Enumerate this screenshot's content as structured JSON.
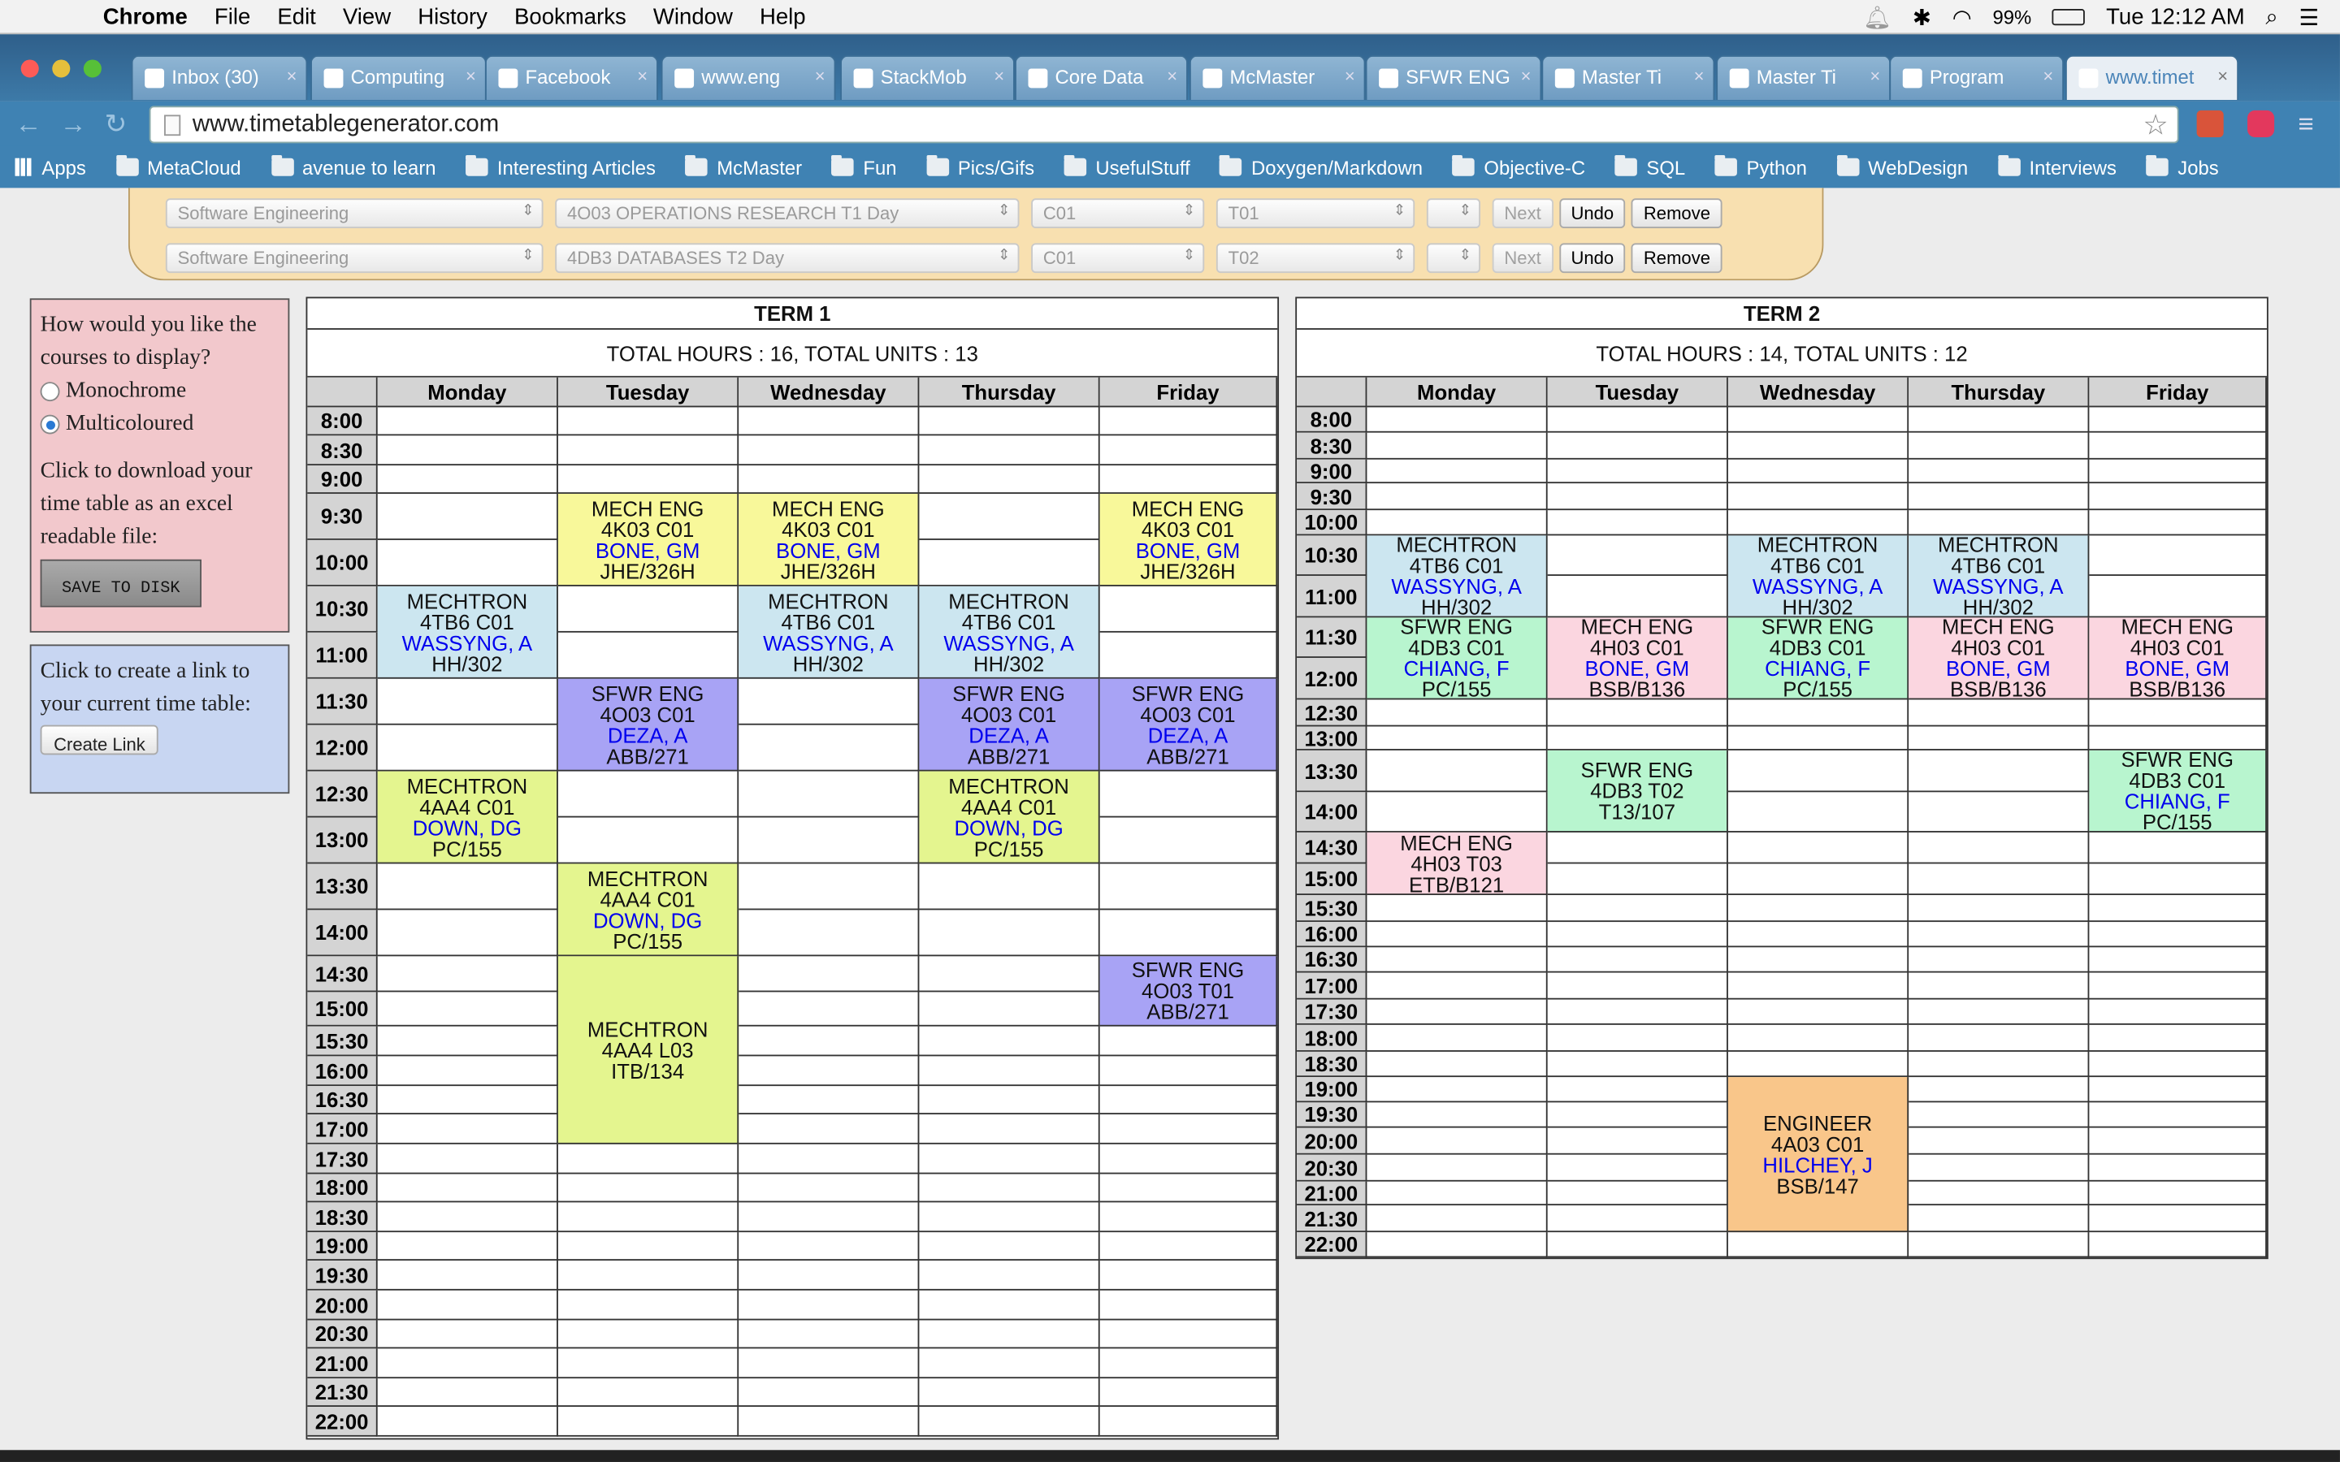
{
  "menubar": {
    "app": "Chrome",
    "items": [
      "File",
      "Edit",
      "View",
      "History",
      "Bookmarks",
      "Window",
      "Help"
    ],
    "battery": "99%",
    "clock": "Tue 12:12 AM"
  },
  "tabs": [
    "Inbox (30)",
    "Computing",
    "Facebook",
    "www.eng",
    "StackMob",
    "Core Data",
    "McMaster",
    "SFWR ENG",
    "Master Ti",
    "Master Ti",
    "Program",
    "www.timet"
  ],
  "url": "www.timetablegenerator.com",
  "bookmarks": [
    "Apps",
    "MetaCloud",
    "avenue to learn",
    "Interesting Articles",
    "McMaster",
    "Fun",
    "Pics/Gifs",
    "UsefulStuff",
    "Doxygen/Markdown",
    "Objective-C",
    "SQL",
    "Python",
    "WebDesign",
    "Interviews",
    "Jobs"
  ],
  "course_rows": [
    {
      "dept": "Software Engineering",
      "course": "4O03 OPERATIONS RESEARCH T1 Day",
      "lec": "C01",
      "tut": "T01",
      "next": "Next",
      "undo": "Undo",
      "remove": "Remove"
    },
    {
      "dept": "Software Engineering",
      "course": "4DB3 DATABASES T2 Day",
      "lec": "C01",
      "tut": "T02",
      "next": "Next",
      "undo": "Undo",
      "remove": "Remove"
    }
  ],
  "sidebar": {
    "display_q": "How would you like the courses to display?",
    "mono": "Monochrome",
    "multi": "Multicoloured",
    "download_text": "Click to download your time table as an excel readable file:",
    "save": "SAVE TO DISK",
    "link_text": "Click to create a link to your current time table:",
    "create_link": "Create Link"
  },
  "days": [
    "Monday",
    "Tuesday",
    "Wednesday",
    "Thursday",
    "Friday"
  ],
  "colors": {
    "yellow": "#f8f89a",
    "blue": "#cce6f0",
    "purple": "#a8a3f5",
    "lime": "#e4f58f",
    "green": "#b8f5cf",
    "pink": "#fbd6e0",
    "orange": "#f9c68a"
  },
  "term1": {
    "title": "TERM 1",
    "totals": "TOTAL HOURS : 16, TOTAL UNITS : 13",
    "times": [
      "8:00",
      "8:30",
      "9:00",
      "9:30",
      "10:00",
      "10:30",
      "11:00",
      "11:30",
      "12:00",
      "12:30",
      "13:00",
      "13:30",
      "14:00",
      "14:30",
      "15:00",
      "15:30",
      "16:00",
      "16:30",
      "17:00",
      "17:30",
      "18:00",
      "18:30",
      "19:00",
      "19:30",
      "20:00",
      "20:30",
      "21:00",
      "21:30",
      "22:00"
    ],
    "courses": [
      {
        "day": 1,
        "start": 3,
        "len": 2,
        "color": "yellow",
        "lines": [
          "MECH ENG",
          "4K03 C01",
          "BONE, GM",
          "JHE/326H"
        ]
      },
      {
        "day": 2,
        "start": 3,
        "len": 2,
        "color": "yellow",
        "lines": [
          "MECH ENG",
          "4K03 C01",
          "BONE, GM",
          "JHE/326H"
        ]
      },
      {
        "day": 4,
        "start": 3,
        "len": 2,
        "color": "yellow",
        "lines": [
          "MECH ENG",
          "4K03 C01",
          "BONE, GM",
          "JHE/326H"
        ]
      },
      {
        "day": 0,
        "start": 5,
        "len": 2,
        "color": "blue",
        "lines": [
          "MECHTRON",
          "4TB6 C01",
          "WASSYNG, A",
          "HH/302"
        ]
      },
      {
        "day": 2,
        "start": 5,
        "len": 2,
        "color": "blue",
        "lines": [
          "MECHTRON",
          "4TB6 C01",
          "WASSYNG, A",
          "HH/302"
        ]
      },
      {
        "day": 3,
        "start": 5,
        "len": 2,
        "color": "blue",
        "lines": [
          "MECHTRON",
          "4TB6 C01",
          "WASSYNG, A",
          "HH/302"
        ]
      },
      {
        "day": 1,
        "start": 7,
        "len": 2,
        "color": "purple",
        "lines": [
          "SFWR ENG",
          "4O03 C01",
          "DEZA, A",
          "ABB/271"
        ]
      },
      {
        "day": 3,
        "start": 7,
        "len": 2,
        "color": "purple",
        "lines": [
          "SFWR ENG",
          "4O03 C01",
          "DEZA, A",
          "ABB/271"
        ]
      },
      {
        "day": 4,
        "start": 7,
        "len": 2,
        "color": "purple",
        "lines": [
          "SFWR ENG",
          "4O03 C01",
          "DEZA, A",
          "ABB/271"
        ]
      },
      {
        "day": 0,
        "start": 9,
        "len": 2,
        "color": "lime",
        "lines": [
          "MECHTRON",
          "4AA4 C01",
          "DOWN, DG",
          "PC/155"
        ]
      },
      {
        "day": 3,
        "start": 9,
        "len": 2,
        "color": "lime",
        "lines": [
          "MECHTRON",
          "4AA4 C01",
          "DOWN, DG",
          "PC/155"
        ]
      },
      {
        "day": 1,
        "start": 11,
        "len": 2,
        "color": "lime",
        "lines": [
          "MECHTRON",
          "4AA4 C01",
          "DOWN, DG",
          "PC/155"
        ]
      },
      {
        "day": 4,
        "start": 13,
        "len": 2,
        "color": "purple",
        "lines": [
          "SFWR ENG",
          "4O03 T01",
          "",
          "ABB/271"
        ]
      },
      {
        "day": 1,
        "start": 13,
        "len": 6,
        "color": "lime",
        "lines": [
          "MECHTRON",
          "4AA4 L03",
          "",
          "ITB/134"
        ]
      }
    ]
  },
  "term2": {
    "title": "TERM 2",
    "totals": "TOTAL HOURS : 14, TOTAL UNITS : 12",
    "times": [
      "8:00",
      "8:30",
      "9:00",
      "9:30",
      "10:00",
      "10:30",
      "11:00",
      "11:30",
      "12:00",
      "12:30",
      "13:00",
      "13:30",
      "14:00",
      "14:30",
      "15:00",
      "15:30",
      "16:00",
      "16:30",
      "17:00",
      "17:30",
      "18:00",
      "18:30",
      "19:00",
      "19:30",
      "20:00",
      "20:30",
      "21:00",
      "21:30",
      "22:00"
    ],
    "courses": [
      {
        "day": 0,
        "start": 5,
        "len": 2,
        "color": "blue",
        "lines": [
          "MECHTRON",
          "4TB6 C01",
          "WASSYNG, A",
          "HH/302"
        ]
      },
      {
        "day": 2,
        "start": 5,
        "len": 2,
        "color": "blue",
        "lines": [
          "MECHTRON",
          "4TB6 C01",
          "WASSYNG, A",
          "HH/302"
        ]
      },
      {
        "day": 3,
        "start": 5,
        "len": 2,
        "color": "blue",
        "lines": [
          "MECHTRON",
          "4TB6 C01",
          "WASSYNG, A",
          "HH/302"
        ]
      },
      {
        "day": 0,
        "start": 7,
        "len": 2,
        "color": "green",
        "lines": [
          "SFWR ENG",
          "4DB3 C01",
          "CHIANG, F",
          "PC/155"
        ]
      },
      {
        "day": 2,
        "start": 7,
        "len": 2,
        "color": "green",
        "lines": [
          "SFWR ENG",
          "4DB3 C01",
          "CHIANG, F",
          "PC/155"
        ]
      },
      {
        "day": 1,
        "start": 7,
        "len": 2,
        "color": "pink",
        "lines": [
          "MECH ENG",
          "4H03 C01",
          "BONE, GM",
          "BSB/B136"
        ]
      },
      {
        "day": 3,
        "start": 7,
        "len": 2,
        "color": "pink",
        "lines": [
          "MECH ENG",
          "4H03 C01",
          "BONE, GM",
          "BSB/B136"
        ]
      },
      {
        "day": 4,
        "start": 7,
        "len": 2,
        "color": "pink",
        "lines": [
          "MECH ENG",
          "4H03 C01",
          "BONE, GM",
          "BSB/B136"
        ]
      },
      {
        "day": 1,
        "start": 11,
        "len": 2,
        "color": "green",
        "lines": [
          "SFWR ENG",
          "4DB3 T02",
          "",
          "T13/107"
        ]
      },
      {
        "day": 4,
        "start": 11,
        "len": 2,
        "color": "green",
        "lines": [
          "SFWR ENG",
          "4DB3 C01",
          "CHIANG, F",
          "PC/155"
        ]
      },
      {
        "day": 0,
        "start": 13,
        "len": 2,
        "color": "pink",
        "lines": [
          "MECH ENG",
          "4H03 T03",
          "",
          "ETB/B121"
        ]
      },
      {
        "day": 2,
        "start": 22,
        "len": 6,
        "color": "orange",
        "lines": [
          "ENGINEER",
          "4A03 C01",
          "HILCHEY, J",
          "BSB/147"
        ]
      }
    ]
  }
}
